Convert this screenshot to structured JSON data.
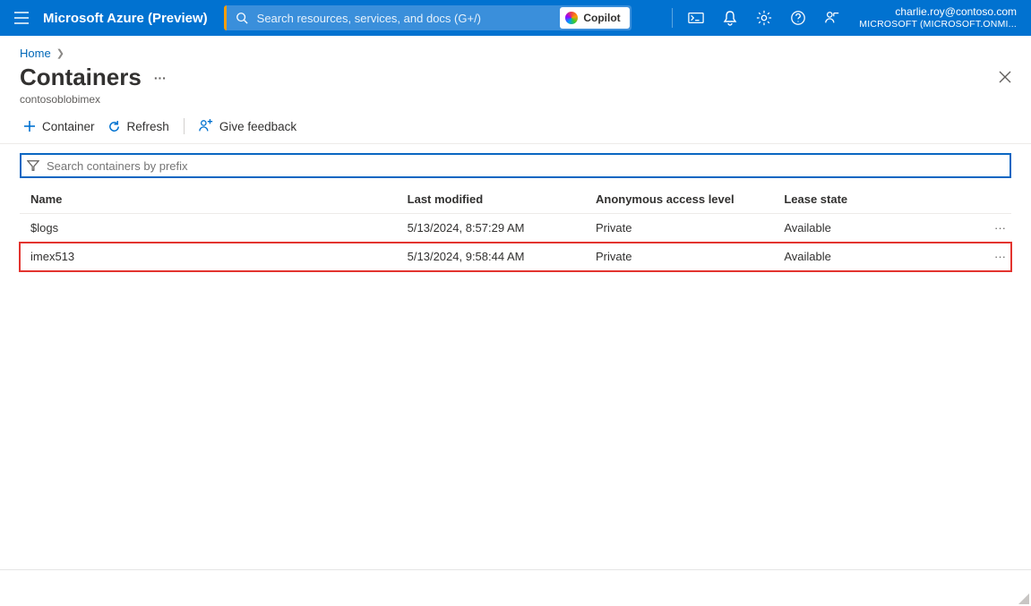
{
  "topbar": {
    "brand": "Microsoft Azure (Preview)",
    "search_placeholder": "Search resources, services, and docs (G+/)",
    "copilot_label": "Copilot",
    "account_email": "charlie.roy@contoso.com",
    "account_org": "MICROSOFT (MICROSOFT.ONMI..."
  },
  "breadcrumb": {
    "items": [
      "Home"
    ]
  },
  "page": {
    "title": "Containers",
    "subtitle": "contosoblobimex"
  },
  "toolbar": {
    "new_container": "Container",
    "refresh": "Refresh",
    "feedback": "Give feedback"
  },
  "filter": {
    "placeholder": "Search containers by prefix"
  },
  "table": {
    "headers": {
      "name": "Name",
      "last_modified": "Last modified",
      "access": "Anonymous access level",
      "lease": "Lease state"
    },
    "rows": [
      {
        "name": "$logs",
        "last_modified": "5/13/2024, 8:57:29 AM",
        "access": "Private",
        "lease": "Available",
        "highlight": false
      },
      {
        "name": "imex513",
        "last_modified": "5/13/2024, 9:58:44 AM",
        "access": "Private",
        "lease": "Available",
        "highlight": true
      }
    ]
  }
}
